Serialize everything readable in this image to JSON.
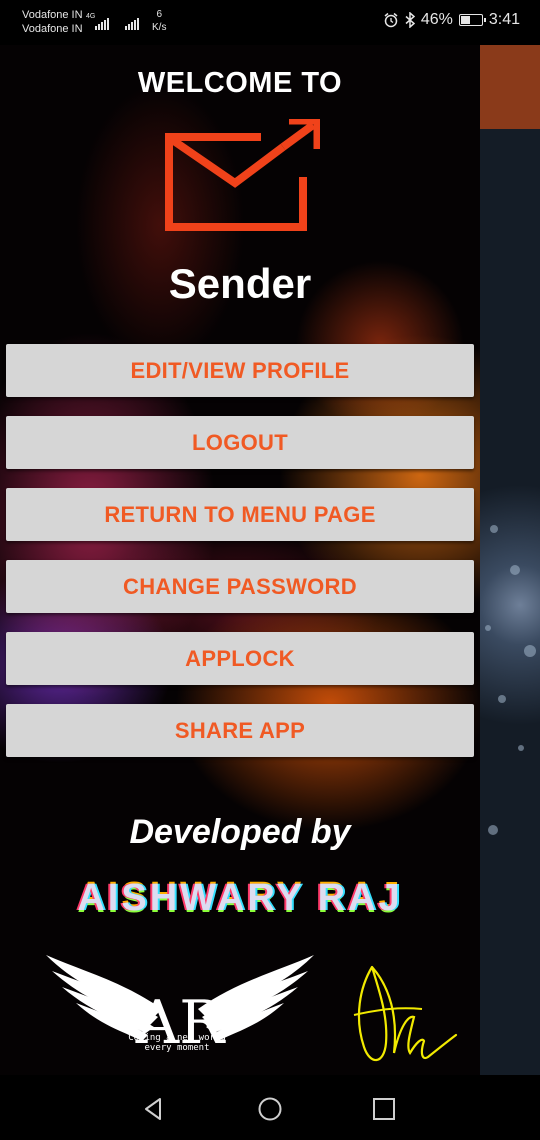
{
  "status_bar": {
    "carrier_1": "Vodafone IN",
    "carrier_2": "Vodafone IN",
    "network": "4G",
    "speed_value": "6",
    "speed_unit": "K/s",
    "battery_percent": "46%",
    "battery_level": 0.46,
    "time": "3:41",
    "icons": [
      "alarm-icon",
      "bluetooth-icon",
      "battery-icon"
    ]
  },
  "drawer": {
    "welcome": "WELCOME TO",
    "app_name": "Sender",
    "buttons": [
      "EDIT/VIEW PROFILE",
      "LOGOUT",
      "RETURN TO MENU PAGE",
      "CHANGE PASSWORD",
      "APPLOCK",
      "SHARE APP"
    ],
    "developed_by": "Developed by",
    "developer_name": "AISHWARY RAJ",
    "wings_logo_text": "Coding a new world every moment"
  },
  "nav_bar": {
    "icons": [
      "back-icon",
      "home-icon",
      "recents-icon"
    ]
  },
  "colors": {
    "accent": "#f05a24",
    "button_bg": "#d6d6d6",
    "signature": "#f2ea00"
  }
}
